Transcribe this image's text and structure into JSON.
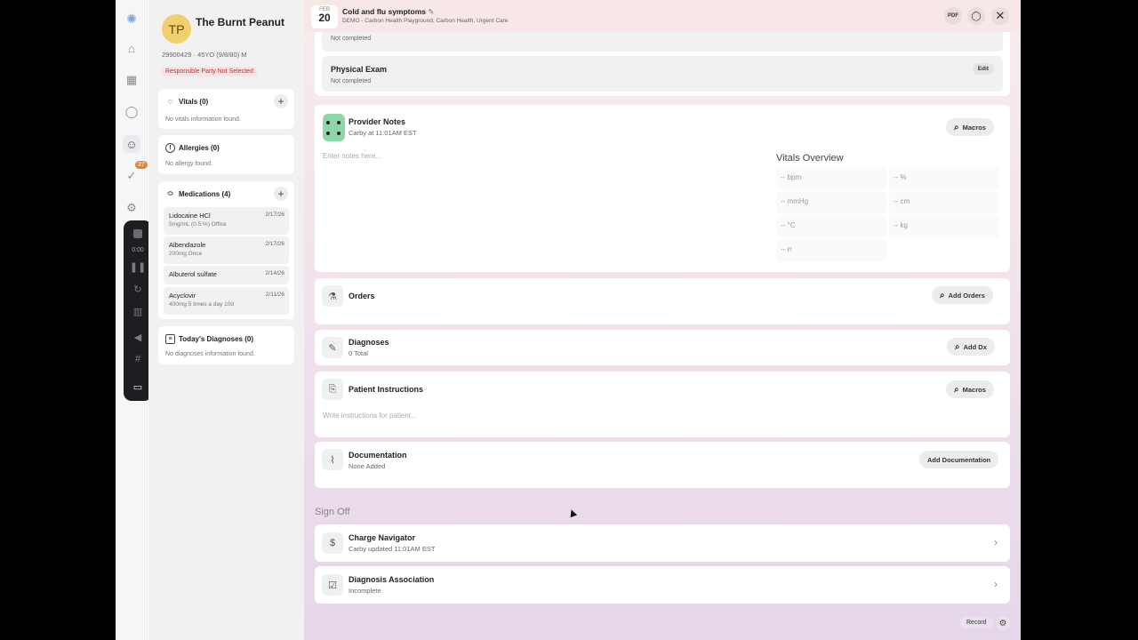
{
  "rail": {
    "logo": "logo-icon",
    "items": [
      "home-icon",
      "calendar-icon",
      "chat-icon",
      "user-icon",
      "check-icon",
      "settings-icon"
    ],
    "badge": "37",
    "recorder": {
      "time": "0:00"
    }
  },
  "patient": {
    "initials": "TP",
    "name": "The Burnt Peanut",
    "info": "29900429 · 45YO (9/8/80) M",
    "responsible_party": "Responsible Party Not Selected"
  },
  "vitals_card": {
    "title": "Vitals (0)",
    "empty": "No vitals information found."
  },
  "allergies_card": {
    "title": "Allergies (0)",
    "empty": "No allergy found."
  },
  "medications_card": {
    "title": "Medications (4)",
    "items": [
      {
        "name": "Lidocaine HCl",
        "date": "2/17/26",
        "sig": "5mg/mL (0.5 %) Office"
      },
      {
        "name": "Albendazole",
        "date": "2/17/26",
        "sig": "200mg Once"
      },
      {
        "name": "Albuterol sulfate",
        "date": "2/14/26",
        "sig": ""
      },
      {
        "name": "Acyclovir",
        "date": "2/11/26",
        "sig": "400mg 5 times a day 10d"
      }
    ]
  },
  "diagnoses_card": {
    "title": "Today's Diagnoses (0)",
    "empty": "No diagnoses information found."
  },
  "header": {
    "month": "FEB",
    "day": "20",
    "visit_title": "Cold and flu symptoms",
    "visit_sub": "DEMO - Carbon Health Playground, Carbon Health, Urgent Care",
    "pdf_label": "PDF"
  },
  "exam_prev": {
    "status": "Not completed"
  },
  "physical_exam": {
    "title": "Physical Exam",
    "status": "Not completed",
    "edit": "Edit"
  },
  "provider_notes": {
    "title": "Provider Notes",
    "sub": "Carby at 11:01AM EST",
    "macros": "Macros",
    "placeholder": "Enter notes here..."
  },
  "vitals_overview": {
    "title": "Vitals Overview",
    "cells": [
      "-- bpm",
      "-- %",
      "-- mmHg",
      "-- cm",
      "-- °C",
      "-- kg",
      "-- rr"
    ]
  },
  "orders": {
    "title": "Orders",
    "button": "Add Orders"
  },
  "diagnoses": {
    "title": "Diagnoses",
    "sub": "0 Total",
    "button": "Add Dx"
  },
  "patient_instructions": {
    "title": "Patient Instructions",
    "button": "Macros",
    "placeholder": "Write instructions for patient..."
  },
  "documentation": {
    "title": "Documentation",
    "sub": "None Added",
    "button": "Add Documentation"
  },
  "signoff": {
    "label": "Sign Off",
    "charge_nav": {
      "title": "Charge Navigator",
      "sub": "Carby updated 11:01AM EST"
    },
    "dx_assoc": {
      "title": "Diagnosis Association",
      "sub": "Incomplete"
    }
  },
  "footer": {
    "record": "Record"
  }
}
